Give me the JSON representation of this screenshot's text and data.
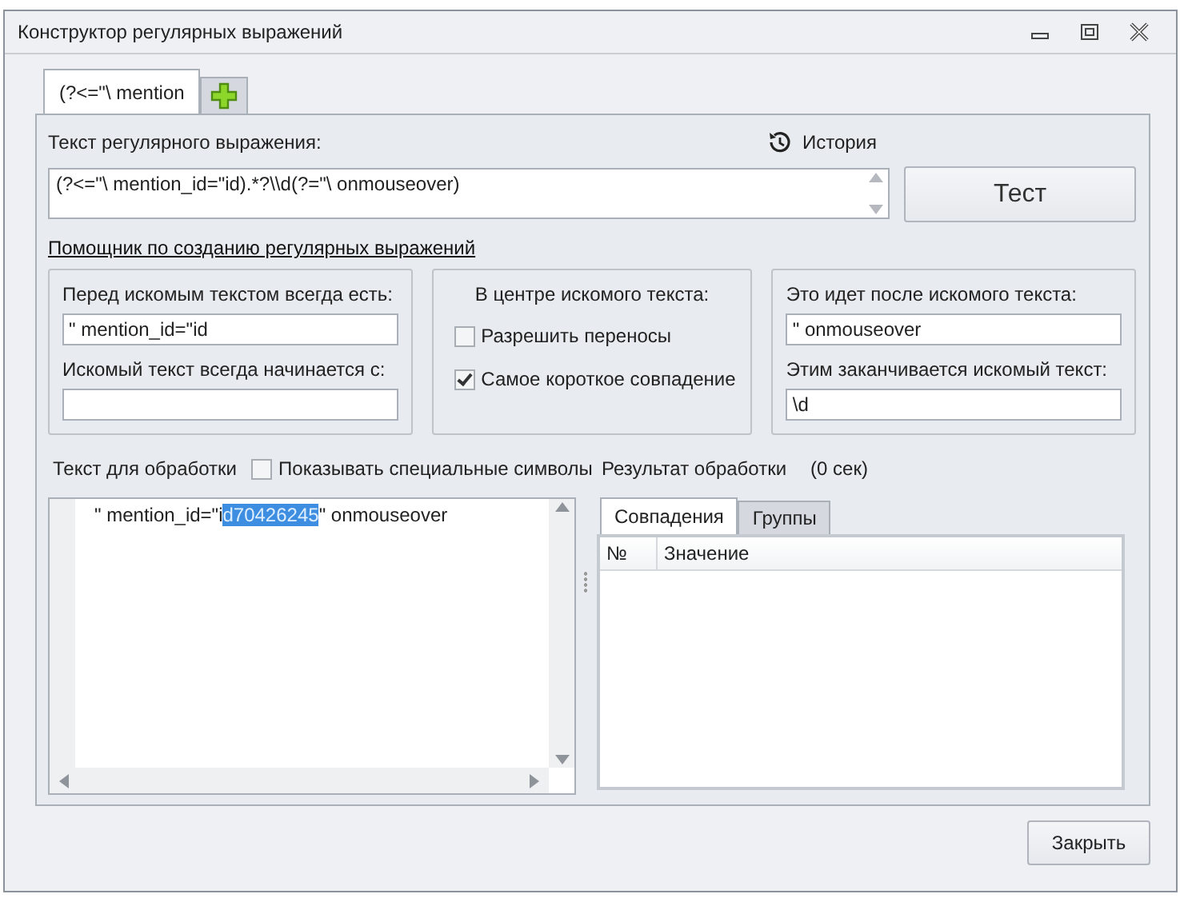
{
  "window": {
    "title": "Конструктор регулярных выражений"
  },
  "tabs": [
    {
      "label": "(?<=\"\\ mention",
      "selected": true
    }
  ],
  "regex": {
    "label": "Текст регулярного выражения:",
    "history": "История",
    "value": "(?<=\"\\ mention_id=\"id).*?\\\\d(?=\"\\ onmouseover)",
    "test_button": "Тест"
  },
  "helper_link": "Помощник по созданию регулярных выражений",
  "before_group": {
    "before_label": "Перед искомым текстом всегда есть:",
    "before_value": "\" mention_id=\"id",
    "starts_label": "Искомый текст всегда начинается с:"
  },
  "center_group": {
    "title": "В центре искомого текста:",
    "options": [
      {
        "label": "Разрешить переносы",
        "checked": false
      },
      {
        "label": "Самое короткое совпадение",
        "checked": true
      }
    ]
  },
  "after_group": {
    "after_label": "Это идет после искомого текста:",
    "after_value": "\" onmouseover",
    "ends_label": "Этим заканчивается искомый текст:",
    "ends_value": "\\d"
  },
  "input_panel": {
    "label": "Текст для обработки",
    "show_special": {
      "label": "Показывать специальные символы",
      "checked": false
    },
    "text_before": "\" mention_id=\"i",
    "selection": "d70426245",
    "text_after": "\" onmouseover"
  },
  "result": {
    "label": "Результат обработки",
    "time": "(0 сек)",
    "tabs": [
      {
        "label": "Совпадения",
        "selected": true
      },
      {
        "label": "Группы",
        "selected": false
      }
    ],
    "columns": [
      "№",
      "Значение"
    ]
  },
  "buttons": [
    "Закрыть"
  ]
}
